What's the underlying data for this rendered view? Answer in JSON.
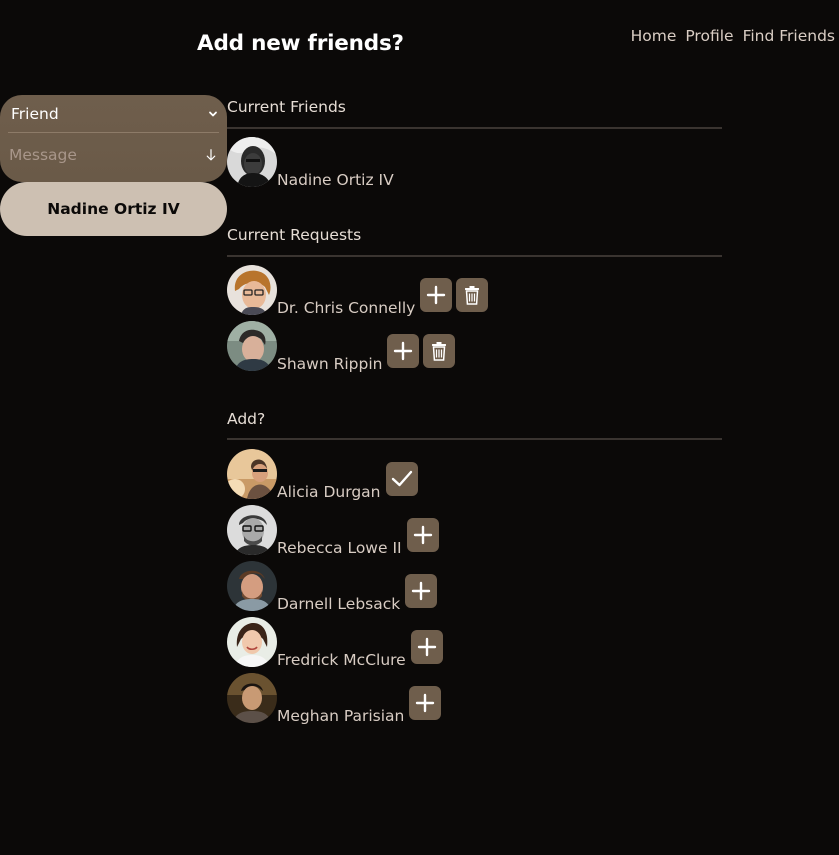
{
  "nav": {
    "home": "Home",
    "profile": "Profile",
    "find_friends": "Find Friends"
  },
  "page_title": "Add new friends?",
  "compose": {
    "select_value": "Friend",
    "message_placeholder": "Message",
    "message_value": "",
    "recipient": "Nadine Ortiz IV"
  },
  "sections": {
    "current_friends": {
      "title": "Current Friends",
      "people": [
        {
          "name": "Nadine Ortiz IV"
        }
      ]
    },
    "current_requests": {
      "title": "Current Requests",
      "people": [
        {
          "name": "Dr. Chris Connelly",
          "actions": [
            "plus-icon",
            "trash-icon"
          ]
        },
        {
          "name": "Shawn Rippin",
          "actions": [
            "plus-icon",
            "trash-icon"
          ]
        }
      ]
    },
    "add": {
      "title": "Add?",
      "people": [
        {
          "name": "Alicia Durgan",
          "action": "check-icon",
          "added": true
        },
        {
          "name": "Rebecca Lowe II",
          "action": "plus-icon",
          "added": false
        },
        {
          "name": "Darnell Lebsack",
          "action": "plus-icon",
          "added": false
        },
        {
          "name": "Fredrick McClure",
          "action": "plus-icon",
          "added": false
        },
        {
          "name": "Meghan Parisian",
          "action": "plus-icon",
          "added": false
        }
      ]
    }
  },
  "colors": {
    "background": "#0b0908",
    "accent": "#6f5e4c",
    "pill": "#cdc0b2",
    "text": "#d8ccc3"
  }
}
